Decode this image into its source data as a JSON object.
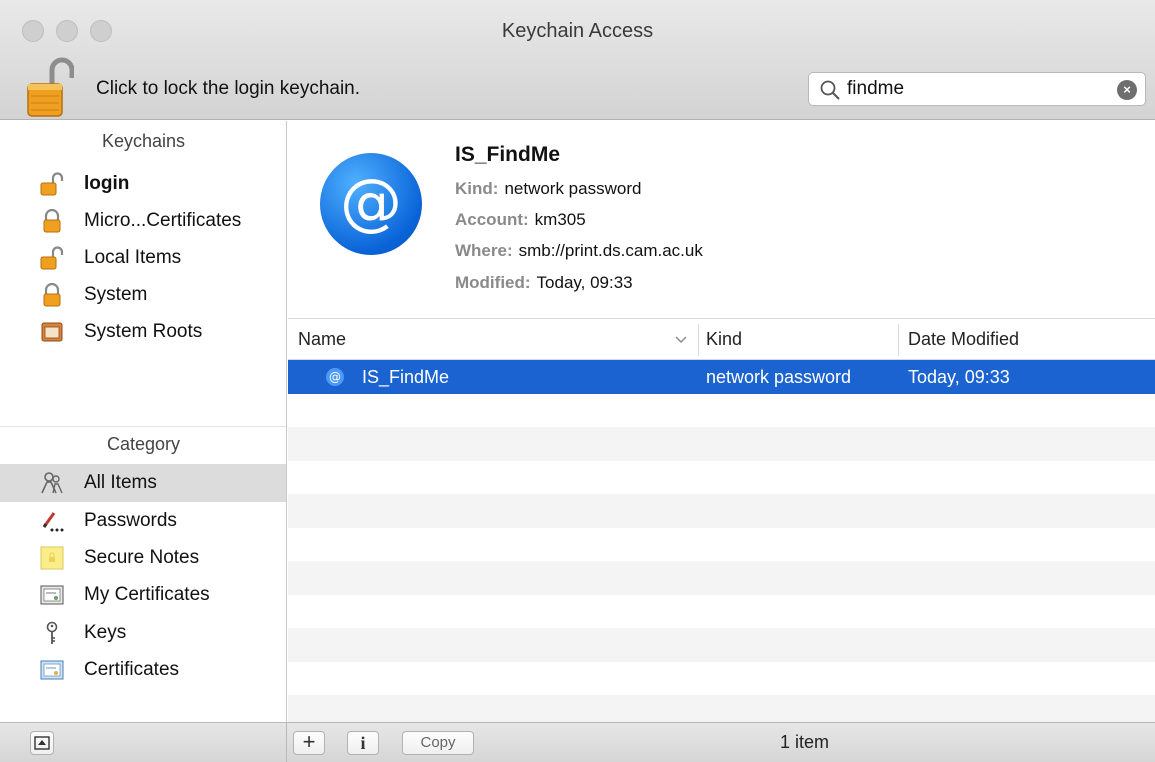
{
  "window": {
    "title": "Keychain Access"
  },
  "toolbar": {
    "lock_label": "Click to lock the login keychain.",
    "search": {
      "value": "findme",
      "placeholder": ""
    }
  },
  "sidebar": {
    "keychains_header": "Keychains",
    "keychains": [
      {
        "label": "login",
        "icon": "unlocked-padlock-icon",
        "bold": true
      },
      {
        "label": "Micro...Certificates",
        "icon": "padlock-icon"
      },
      {
        "label": "Local Items",
        "icon": "unlocked-padlock-icon"
      },
      {
        "label": "System",
        "icon": "padlock-icon"
      },
      {
        "label": "System Roots",
        "icon": "cabinet-icon"
      }
    ],
    "category_header": "Category",
    "categories": [
      {
        "label": "All Items",
        "icon": "people-icon",
        "selected": true
      },
      {
        "label": "Passwords",
        "icon": "pencil-dots-icon"
      },
      {
        "label": "Secure Notes",
        "icon": "note-icon"
      },
      {
        "label": "My Certificates",
        "icon": "certificate-icon"
      },
      {
        "label": "Keys",
        "icon": "key-icon"
      },
      {
        "label": "Certificates",
        "icon": "certificate-icon"
      }
    ]
  },
  "detail": {
    "name": "IS_FindMe",
    "kind_label": "Kind:",
    "kind": "network password",
    "account_label": "Account:",
    "account": "km305",
    "where_label": "Where:",
    "where": "smb://print.ds.cam.ac.uk",
    "modified_label": "Modified:",
    "modified": "Today, 09:33"
  },
  "table": {
    "columns": [
      "Name",
      "Kind",
      "Date Modified"
    ],
    "rows": [
      {
        "name": "IS_FindMe",
        "kind": "network password",
        "date_modified": "Today, 09:33",
        "selected": true
      }
    ]
  },
  "bottombar": {
    "add_label": "+",
    "info_label": "i",
    "copy_label": "Copy",
    "status": "1 item"
  },
  "colors": {
    "selection": "#1b63d1",
    "accent_blue": "#1b7ef0"
  }
}
